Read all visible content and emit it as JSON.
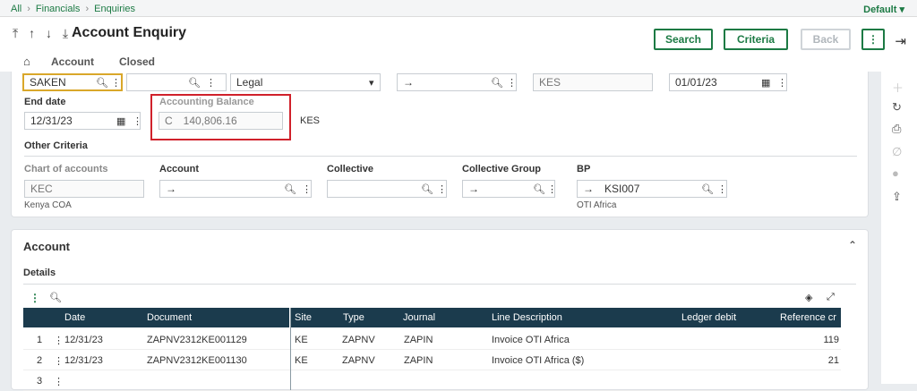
{
  "breadcrumb": {
    "items": [
      "All",
      "Financials",
      "Enquiries"
    ]
  },
  "default_selector": "Default",
  "header": {
    "title": "Account Enquiry",
    "nav_arrows": "⤒ ↑ ↓ ⤓"
  },
  "buttons": {
    "search": "Search",
    "criteria": "Criteria",
    "back": "Back",
    "more": "⋮"
  },
  "tabs": [
    "Account",
    "Closed"
  ],
  "criteria": {
    "company_value": "SAKEN",
    "field2_value": "",
    "ledger_type": "Legal",
    "field4_value": "→",
    "currency_value": "KES",
    "start_date": "01/01/23",
    "end_date_label": "End date",
    "end_date": "12/31/23",
    "balance_label": "Accounting Balance",
    "balance_prefix": "C",
    "balance_value": "140,806.16",
    "balance_currency": "KES",
    "other_criteria_label": "Other Criteria",
    "coa_label": "Chart of accounts",
    "coa_value": "KEC",
    "coa_sub": "Kenya COA",
    "account_label": "Account",
    "account_value": "→",
    "collective_label": "Collective",
    "collective_value": "",
    "collective_group_label": "Collective Group",
    "collective_group_value": "→",
    "bp_label": "BP",
    "bp_arrow": "→",
    "bp_value": "KSI007",
    "bp_sub": "OTI Africa"
  },
  "account_section": {
    "title": "Account",
    "details_label": "Details",
    "columns": [
      "Date",
      "Document",
      "Site",
      "Type",
      "Journal",
      "Line Description",
      "Ledger debit",
      "Reference cr"
    ],
    "rows": [
      {
        "num": "1",
        "date": "12/31/23",
        "document": "ZAPNV2312KE001129",
        "site": "KE",
        "type": "ZAPNV",
        "journal": "ZAPIN",
        "line_description": "Invoice OTI Africa",
        "ledger_debit": "",
        "reference_credit": "119"
      },
      {
        "num": "2",
        "date": "12/31/23",
        "document": "ZAPNV2312KE001130",
        "site": "KE",
        "type": "ZAPNV",
        "journal": "ZAPIN",
        "line_description": "Invoice OTI Africa ($)",
        "ledger_debit": "",
        "reference_credit": "21"
      },
      {
        "num": "3",
        "date": "",
        "document": "",
        "site": "",
        "type": "",
        "journal": "",
        "line_description": "",
        "ledger_debit": "",
        "reference_credit": ""
      }
    ]
  }
}
